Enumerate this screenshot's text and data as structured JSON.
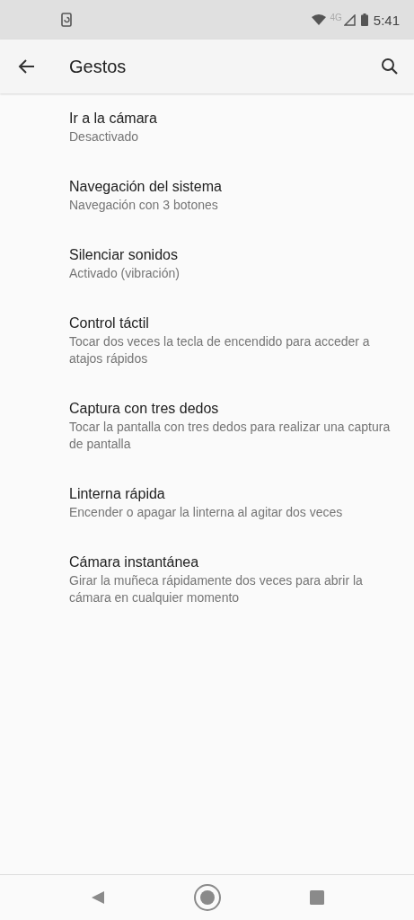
{
  "status_bar": {
    "network": "4G",
    "time": "5:41"
  },
  "toolbar": {
    "title": "Gestos"
  },
  "items": [
    {
      "title": "Ir a la cámara",
      "summary": "Desactivado"
    },
    {
      "title": "Navegación del sistema",
      "summary": "Navegación con 3 botones"
    },
    {
      "title": "Silenciar sonidos",
      "summary": "Activado (vibración)"
    },
    {
      "title": "Control táctil",
      "summary": "Tocar dos veces la tecla de encendido para acceder a atajos rápidos"
    },
    {
      "title": "Captura con tres dedos",
      "summary": "Tocar la pantalla con tres dedos para realizar una captura de pantalla"
    },
    {
      "title": "Linterna rápida",
      "summary": "Encender o apagar la linterna al agitar dos veces"
    },
    {
      "title": "Cámara instantánea",
      "summary": "Girar la muñeca rápidamente dos veces para abrir la cámara en cualquier momento"
    }
  ]
}
